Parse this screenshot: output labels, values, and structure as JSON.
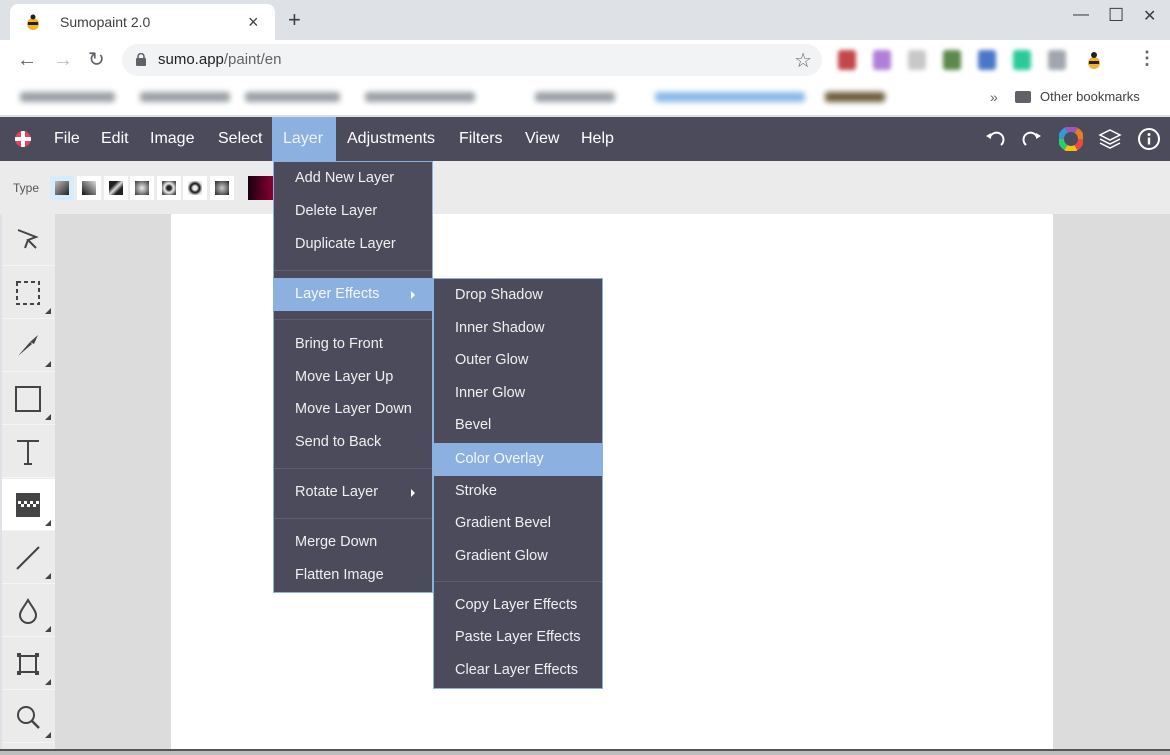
{
  "browser": {
    "tab_title": "Sumopaint 2.0",
    "tab_close": "×",
    "new_tab": "+",
    "url_host": "sumo.app",
    "url_path": "/paint/en",
    "other_bookmarks": "Other bookmarks",
    "bookmarks_overflow": "»",
    "window_controls": {
      "minimize": "—",
      "maximize": "☐",
      "close": "✕"
    },
    "nav": {
      "back": "←",
      "forward": "→",
      "reload": "↻"
    },
    "star": "☆",
    "menu": "⋮"
  },
  "app": {
    "menubar": {
      "items": [
        {
          "label": "File"
        },
        {
          "label": "Edit"
        },
        {
          "label": "Image"
        },
        {
          "label": "Select"
        },
        {
          "label": "Layer",
          "active": true
        },
        {
          "label": "Adjustments"
        },
        {
          "label": "Filters"
        },
        {
          "label": "View"
        },
        {
          "label": "Help"
        }
      ],
      "right_icons": [
        "undo-icon",
        "redo-icon",
        "color-wheel-icon",
        "layers-icon",
        "info-icon"
      ]
    },
    "options_bar": {
      "type_label": "Type",
      "gradient_types": [
        "linear",
        "diagonal",
        "reflected-diagonal",
        "square",
        "radial",
        "radial-ring",
        "square-soft"
      ],
      "selected_type_index": 0,
      "color_from": "#1a0010",
      "color_to": "#8c0030"
    },
    "tools": [
      {
        "name": "move-tool",
        "has_submenu": false
      },
      {
        "name": "selection-tool",
        "has_submenu": true
      },
      {
        "name": "brush-tool",
        "has_submenu": true
      },
      {
        "name": "shape-tool",
        "has_submenu": true
      },
      {
        "name": "text-tool",
        "has_submenu": false
      },
      {
        "name": "gradient-tool",
        "has_submenu": true,
        "selected": true
      },
      {
        "name": "line-tool",
        "has_submenu": true
      },
      {
        "name": "blur-tool",
        "has_submenu": true
      },
      {
        "name": "transform-tool",
        "has_submenu": true
      },
      {
        "name": "zoom-tool",
        "has_submenu": true
      }
    ],
    "layer_menu": {
      "groups": [
        [
          "Add New Layer",
          "Delete Layer",
          "Duplicate Layer"
        ],
        [
          "Layer Effects"
        ],
        [
          "Bring to Front",
          "Move Layer Up",
          "Move Layer Down",
          "Send to Back"
        ],
        [
          "Rotate Layer"
        ],
        [
          "Merge Down",
          "Flatten Image"
        ]
      ],
      "highlighted": "Layer Effects"
    },
    "layer_effects_menu": {
      "groups": [
        [
          "Drop Shadow",
          "Inner Shadow",
          "Outer Glow",
          "Inner Glow",
          "Bevel",
          "Color Overlay",
          "Stroke",
          "Gradient Bevel",
          "Gradient Glow"
        ],
        [
          "Copy Layer Effects",
          "Paste Layer Effects",
          "Clear Layer Effects"
        ]
      ],
      "highlighted": "Color Overlay"
    },
    "colors": {
      "menubar_bg": "#4b4b5c",
      "accent": "#8cb0e0"
    }
  }
}
